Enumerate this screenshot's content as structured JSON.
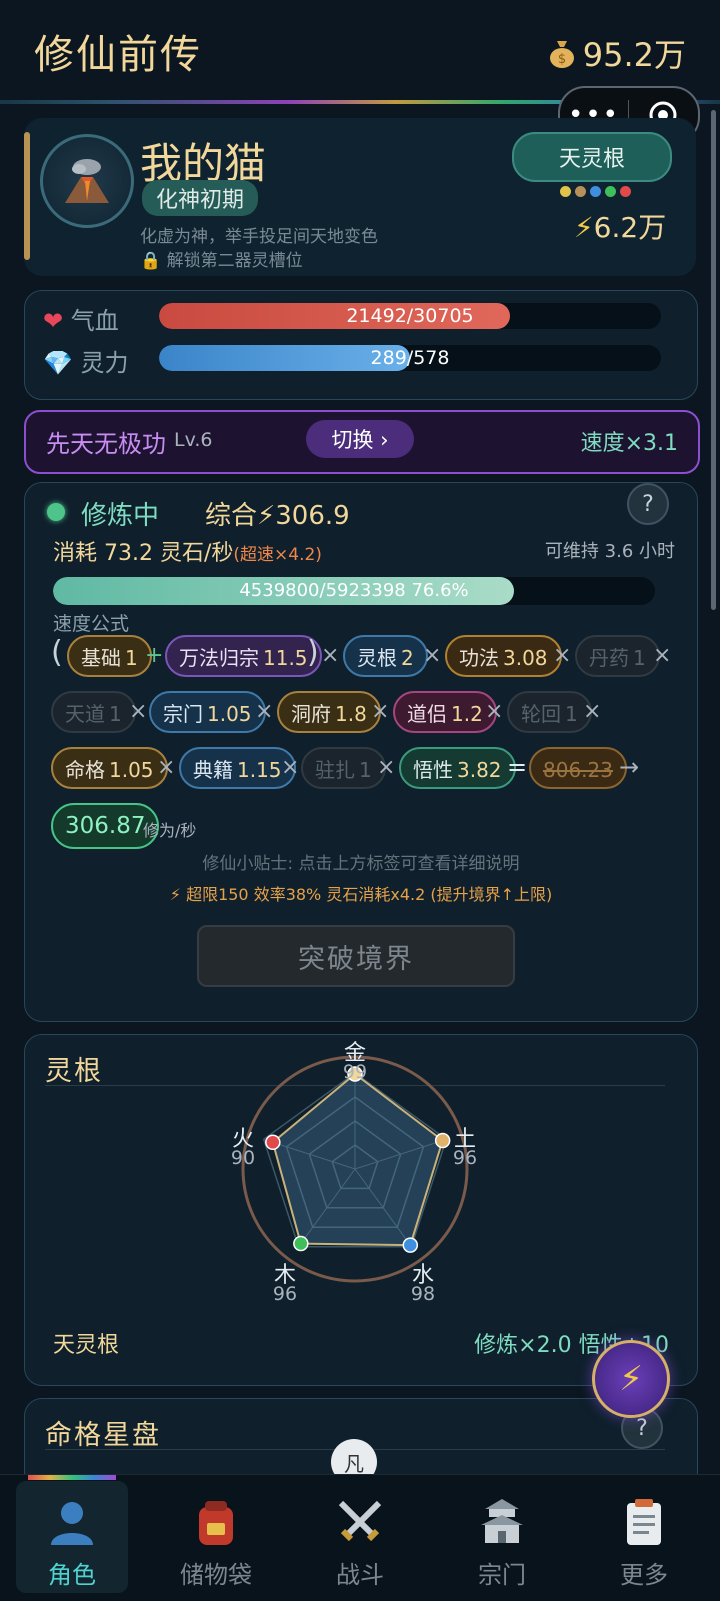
{
  "header": {
    "title": "修仙前传",
    "money": "95.2万"
  },
  "profile": {
    "name": "我的猫",
    "realm": "化神初期",
    "desc": "化虚为神，举手投足间天地变色",
    "unlock": "解锁第二器灵槽位",
    "root_tag": "天灵根",
    "power": "6.2万",
    "root_dot_colors": [
      "#e0c34a",
      "#b8905a",
      "#3f8fe0",
      "#3fbf5a",
      "#e04a4a"
    ]
  },
  "stats": {
    "hp_label": "气血",
    "hp_text": "21492/30705",
    "hp_ratio": 0.6999,
    "mp_label": "灵力",
    "mp_text": "289/578",
    "mp_ratio": 0.5
  },
  "technique": {
    "name": "先天无极功",
    "level": "Lv.6",
    "switch": "切换 ›",
    "speed": "速度×3.1"
  },
  "cultivation": {
    "status": "修炼中",
    "total": "综合⚡306.9",
    "consume": "消耗 73.2 灵石/秒",
    "consume_boost": "(超速×4.2)",
    "sustain": "可维持 3.6 小时",
    "exp_text": "4539800/5923398  76.6%",
    "exp_ratio": 0.766,
    "formula_label": "速度公式",
    "factors": {
      "base": {
        "label": "基础",
        "value": "1"
      },
      "wanfa": {
        "label": "万法归宗",
        "value": "11.5"
      },
      "root": {
        "label": "灵根",
        "value": "2"
      },
      "gongfa": {
        "label": "功法",
        "value": "3.08"
      },
      "danyao": {
        "label": "丹药",
        "value": "1"
      },
      "tiandao": {
        "label": "天道",
        "value": "1"
      },
      "zongmen": {
        "label": "宗门",
        "value": "1.05"
      },
      "dongfu": {
        "label": "洞府",
        "value": "1.8"
      },
      "daolv": {
        "label": "道侣",
        "value": "1.2"
      },
      "lunhui": {
        "label": "轮回",
        "value": "1"
      },
      "mingge": {
        "label": "命格",
        "value": "1.05"
      },
      "dianji": {
        "label": "典籍",
        "value": "1.15"
      },
      "zhuzha": {
        "label": "驻扎",
        "value": "1"
      },
      "wuxing": {
        "label": "悟性",
        "value": "3.82"
      }
    },
    "old_result": "806.23",
    "result": "306.87",
    "result_unit": "修为/秒",
    "tip": "修仙小贴士: 点击上方标签可查看详细说明",
    "warning": "⚡ 超限150 效率38% 灵石消耗x4.2 (提升境界↑上限)",
    "breakthrough": "突破境界"
  },
  "spirit_root": {
    "title": "灵根",
    "elements": [
      {
        "name": "金",
        "value": 99,
        "color": "#f2d79a"
      },
      {
        "name": "土",
        "value": 96,
        "color": "#e0b26a"
      },
      {
        "name": "水",
        "value": 98,
        "color": "#3f8fe0"
      },
      {
        "name": "木",
        "value": 96,
        "color": "#3fbf5a"
      },
      {
        "name": "火",
        "value": 90,
        "color": "#e04a4a"
      }
    ],
    "type": "天灵根",
    "bonus": "修炼×2.0  悟性+10"
  },
  "fate": {
    "title": "命格星盘",
    "badge": "凡"
  },
  "nav": [
    {
      "label": "角色",
      "icon": "character-icon"
    },
    {
      "label": "储物袋",
      "icon": "bag-icon"
    },
    {
      "label": "战斗",
      "icon": "swords-icon"
    },
    {
      "label": "宗门",
      "icon": "temple-icon"
    },
    {
      "label": "更多",
      "icon": "clipboard-icon"
    }
  ]
}
